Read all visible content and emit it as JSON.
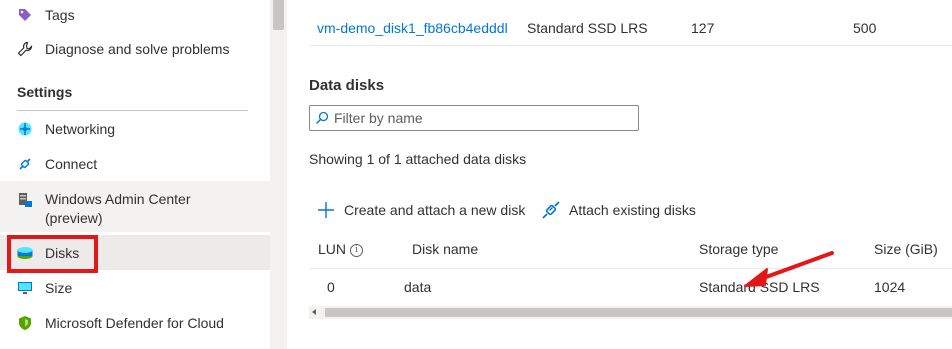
{
  "sidebar": {
    "items_top": [
      {
        "label": "Tags",
        "icon": "tag-icon"
      },
      {
        "label": "Diagnose and solve problems",
        "icon": "wrench-icon"
      }
    ],
    "section_title": "Settings",
    "items": [
      {
        "label": "Networking",
        "icon": "networking-icon"
      },
      {
        "label": "Connect",
        "icon": "connect-icon"
      },
      {
        "label_line1": "Windows Admin Center",
        "label_line2": "(preview)",
        "icon": "windows-admin-center-icon"
      },
      {
        "label": "Disks",
        "icon": "disks-icon"
      },
      {
        "label": "Size",
        "icon": "monitor-icon"
      },
      {
        "label": "Microsoft Defender for Cloud",
        "icon": "shield-icon"
      }
    ]
  },
  "os_disk_row": {
    "name": "vm-demo_disk1_fb86cb4edddl",
    "storage_type": "Standard SSD LRS",
    "size": "127",
    "iops": "500"
  },
  "data_disks": {
    "title": "Data disks",
    "filter_placeholder": "Filter by name",
    "showing_text": "Showing 1 of 1 attached data disks",
    "commands": {
      "create": "Create and attach a new disk",
      "attach": "Attach existing disks"
    },
    "columns": {
      "lun": "LUN",
      "disk_name": "Disk name",
      "storage_type": "Storage type",
      "size": "Size (GiB)"
    },
    "rows": [
      {
        "lun": "0",
        "disk_name": "data",
        "storage_type": "Standard SSD LRS",
        "size": "1024"
      }
    ]
  },
  "colors": {
    "accent": "#0078d4",
    "highlight": "#e31717",
    "text": "#323130"
  }
}
